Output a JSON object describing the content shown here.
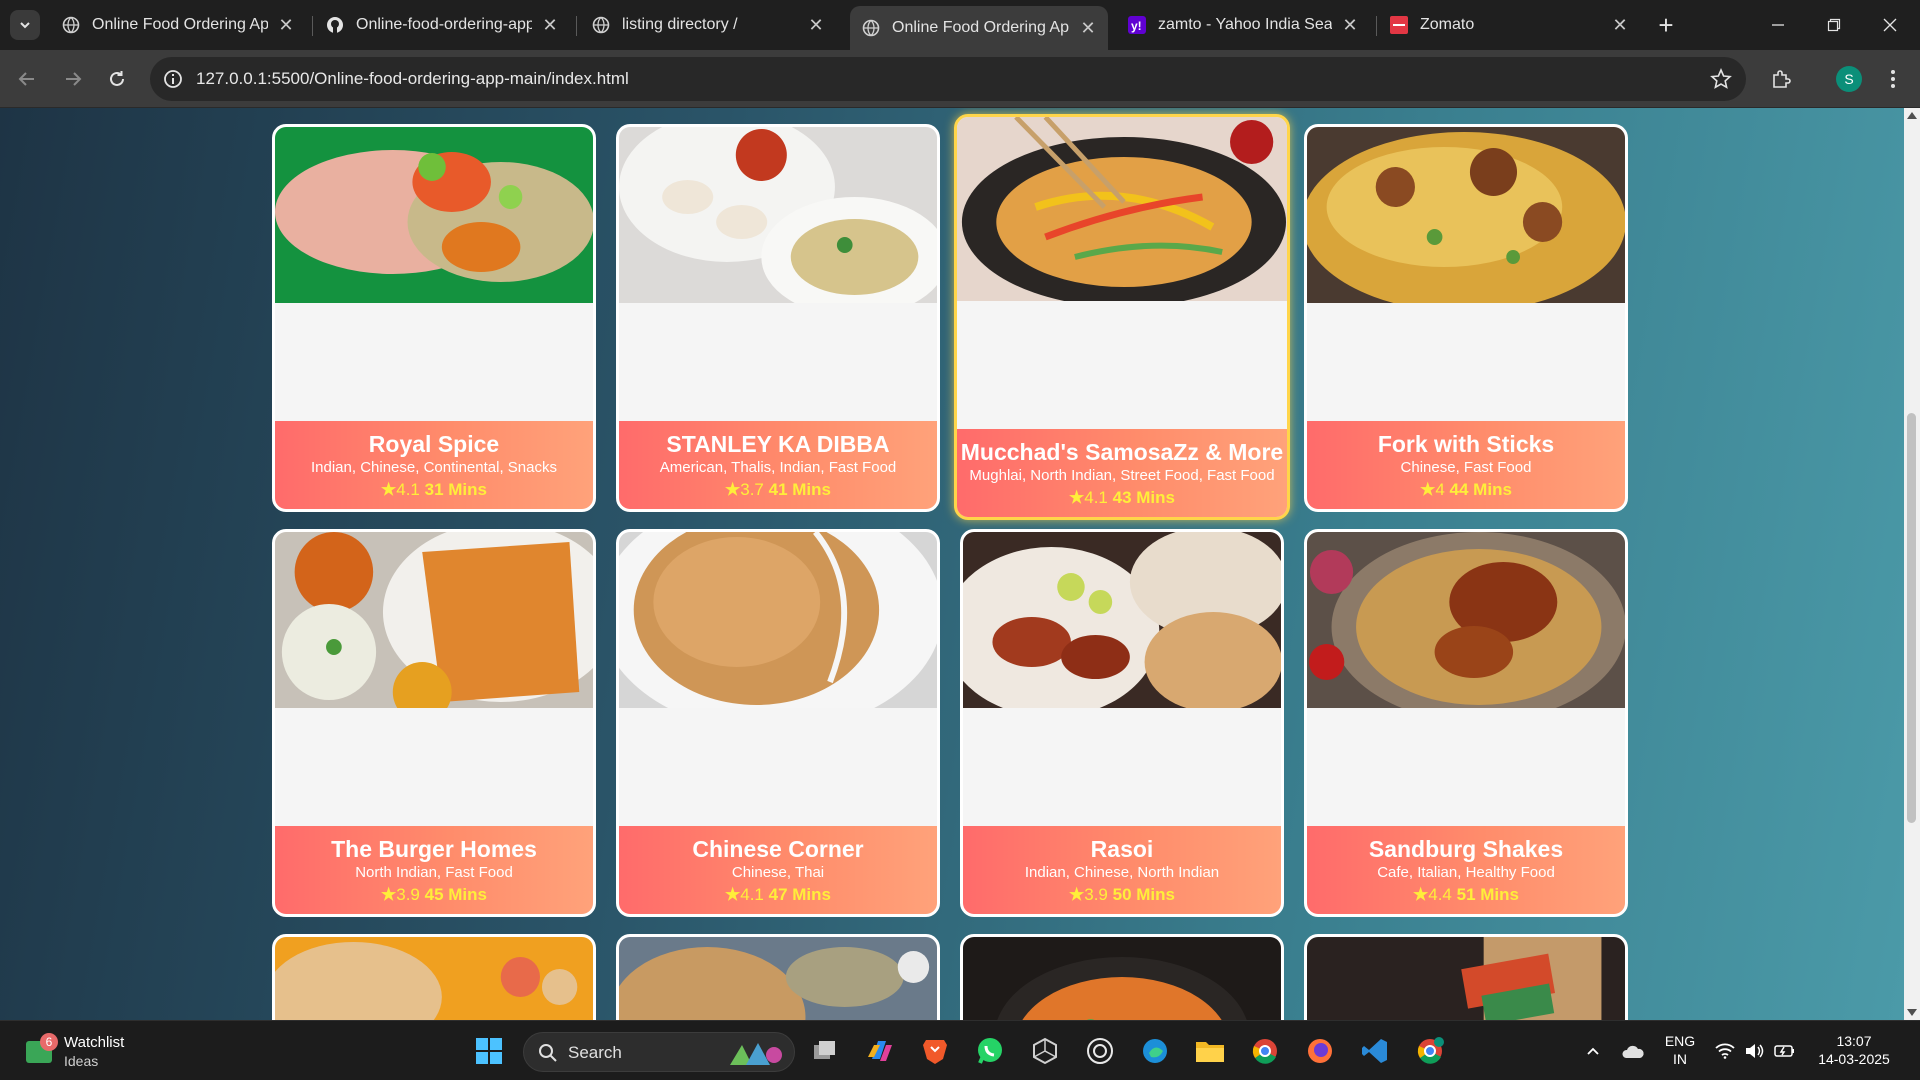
{
  "browser": {
    "tabs": [
      {
        "title": "Online Food Ordering App",
        "favicon": "globe-icon",
        "active": false
      },
      {
        "title": "Online-food-ordering-app",
        "favicon": "github-icon",
        "active": false
      },
      {
        "title": "listing directory /",
        "favicon": "globe-icon",
        "active": false
      },
      {
        "title": "Online Food Ordering App",
        "favicon": "globe-icon",
        "active": true
      },
      {
        "title": "zamto - Yahoo India Search",
        "favicon": "yahoo-icon",
        "active": false
      },
      {
        "title": "Zomato",
        "favicon": "zomato-icon",
        "active": false
      }
    ],
    "url": "127.0.0.1:5500/Online-food-ordering-app-main/index.html",
    "profile_initial": "S"
  },
  "restaurants": [
    {
      "name": "Royal Spice",
      "cuisine": "Indian, Chinese, Continental, Snacks",
      "rating": "4.1",
      "time": "31 Mins",
      "photo": "wrap-photo"
    },
    {
      "name": "STANLEY KA DIBBA",
      "cuisine": "American, Thalis, Indian, Fast Food",
      "rating": "3.7",
      "time": "41 Mins",
      "photo": "momos-photo"
    },
    {
      "name": "Mucchad's SamosaZz & More",
      "cuisine": "Mughlai, North Indian, Street Food, Fast Food",
      "rating": "4.1",
      "time": "43 Mins",
      "photo": "noodles-photo"
    },
    {
      "name": "Fork with Sticks",
      "cuisine": "Chinese, Fast Food",
      "rating": "4",
      "time": "44 Mins",
      "photo": "biryani-photo"
    },
    {
      "name": "The Burger Homes",
      "cuisine": "North Indian, Fast Food",
      "rating": "3.9",
      "time": "45 Mins",
      "photo": "dosa-photo"
    },
    {
      "name": "Chinese Corner",
      "cuisine": "Chinese, Thai",
      "rating": "4.1",
      "time": "47 Mins",
      "photo": "masala-dosa-photo"
    },
    {
      "name": "Rasoi",
      "cuisine": "Indian, Chinese, North Indian",
      "rating": "3.9",
      "time": "50 Mins",
      "photo": "tandoori-photo"
    },
    {
      "name": "Sandburg Shakes",
      "cuisine": "Cafe, Italian, Healthy Food",
      "rating": "4.4",
      "time": "51 Mins",
      "photo": "chicken-biryani-photo"
    }
  ],
  "taskbar": {
    "widget_title": "Watchlist",
    "widget_subtitle": "Ideas",
    "widget_badge": "6",
    "search_label": "Search",
    "language_top": "ENG",
    "language_bottom": "IN",
    "time": "13:07",
    "date": "14-03-2025"
  }
}
